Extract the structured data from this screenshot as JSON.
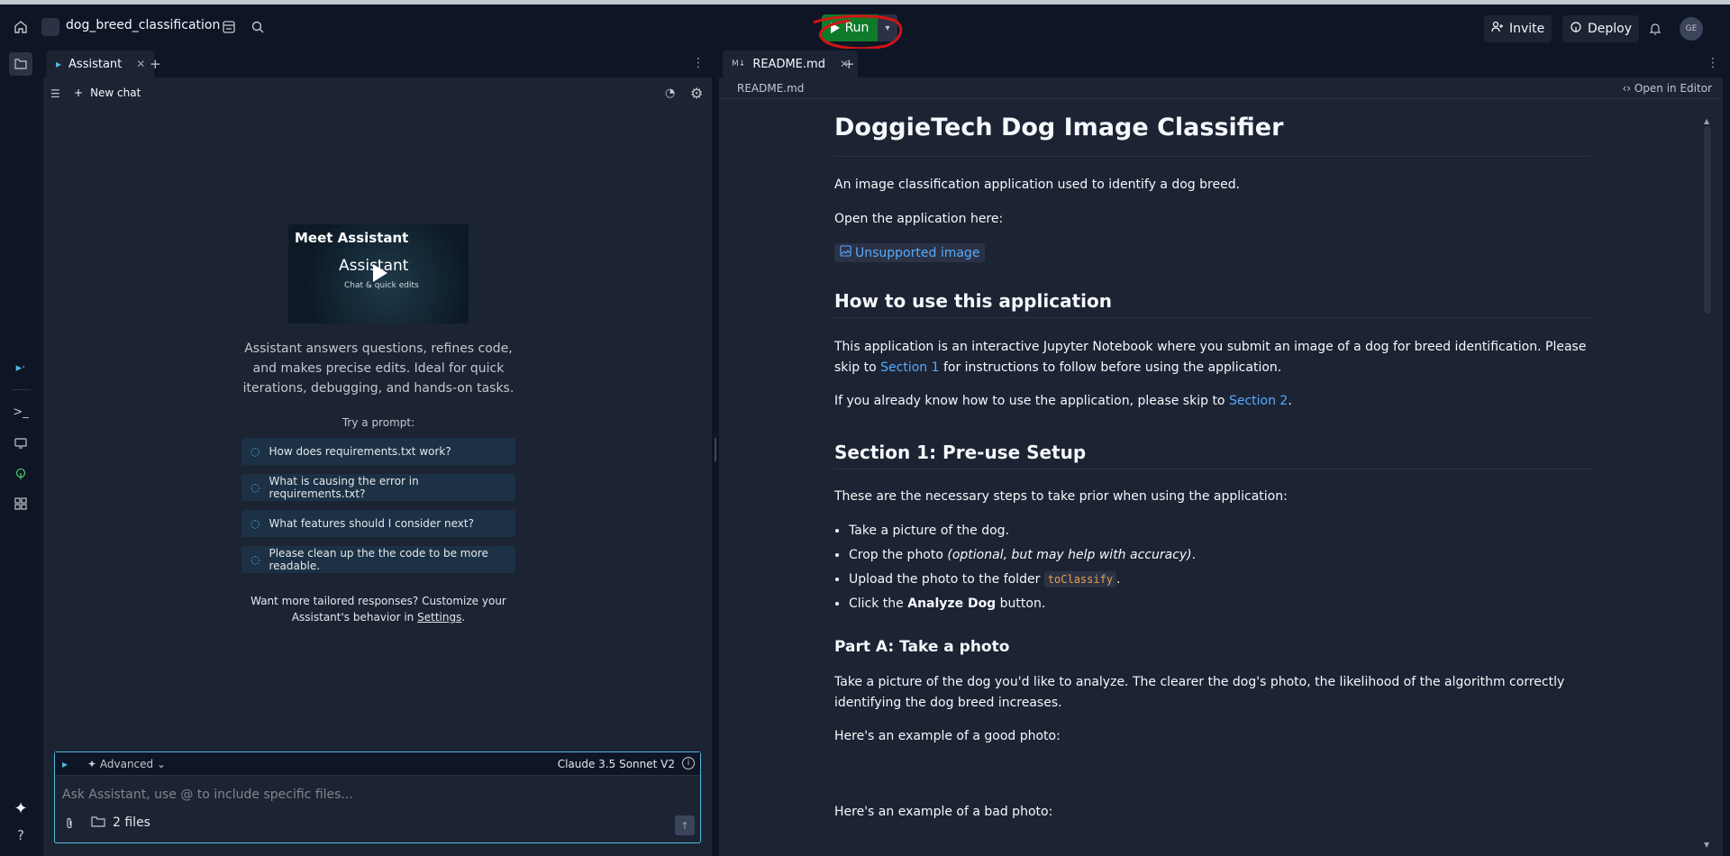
{
  "top_bar": {
    "repl_name": "dog_breed_classification",
    "run_label": "Run",
    "invite_label": "Invite",
    "deploy_label": "Deploy",
    "avatar_initials": "GE"
  },
  "assistant_pane": {
    "tab_label": "Assistant",
    "new_chat_label": "New chat",
    "video": {
      "title": "Meet Assistant",
      "brand": "Assistant",
      "subtitle": "Chat & quick edits"
    },
    "intro_text": "Assistant answers questions, refines code, and makes precise edits. Ideal for quick iterations, debugging, and hands-on tasks.",
    "try_label": "Try a prompt:",
    "prompts": [
      "How does requirements.txt work?",
      "What is causing the error in requirements.txt?",
      "What features should I consider next?",
      "Please clean up the the code to be more readable."
    ],
    "tailored_text": "Want more tailored responses? Customize your Assistant's behavior in",
    "settings_link": "Settings",
    "tailored_end": ".",
    "composer": {
      "mode_label": "Advanced",
      "model_label": "Claude 3.5 Sonnet V2",
      "placeholder": "Ask Assistant, use @ to include specific files...",
      "files_label": "2 files"
    }
  },
  "readme_pane": {
    "tab_label": "README.md",
    "breadcrumb": "README.md",
    "open_in_editor": "Open in Editor",
    "h1": "DoggieTech Dog Image Classifier",
    "p_intro": "An image classification application used to identify a dog breed.",
    "p_open": "Open the application here:",
    "unsupported_image": "Unsupported image",
    "h2_how": "How to use this application",
    "p_how_a": "This application is an interactive Jupyter Notebook where you submit an image of a dog for breed identification. Please skip to",
    "link_section1": "Section 1",
    "p_how_b": "for instructions to follow before using the application.",
    "p_know_a": "If you already know how to use the application, please skip to",
    "link_section2": "Section 2",
    "p_know_b": ".",
    "h2_section1": "Section 1: Pre-use Setup",
    "p_steps": "These are the necessary steps to take prior when using the application:",
    "steps": {
      "s1": "Take a picture of the dog.",
      "s2_a": "Crop the photo",
      "s2_em": "(optional, but may help with accuracy)",
      "s2_b": ".",
      "s3_a": "Upload the photo to the folder",
      "s3_code": "toClassify",
      "s3_b": ".",
      "s4_a": "Click the",
      "s4_strong": "Analyze Dog",
      "s4_b": "button."
    },
    "h3_part_a": "Part A: Take a photo",
    "p_part_a": "Take a picture of the dog you'd like to analyze. The clearer the dog's photo, the likelihood of the algorithm correctly identifying the dog breed increases.",
    "p_good": "Here's an example of a good photo:",
    "p_bad": "Here's an example of a bad photo:"
  },
  "colors": {
    "run_green": "#0f7b2a",
    "annotation_red": "#d21414",
    "link_blue": "#57abff",
    "accent_cyan": "#56b8e0"
  }
}
